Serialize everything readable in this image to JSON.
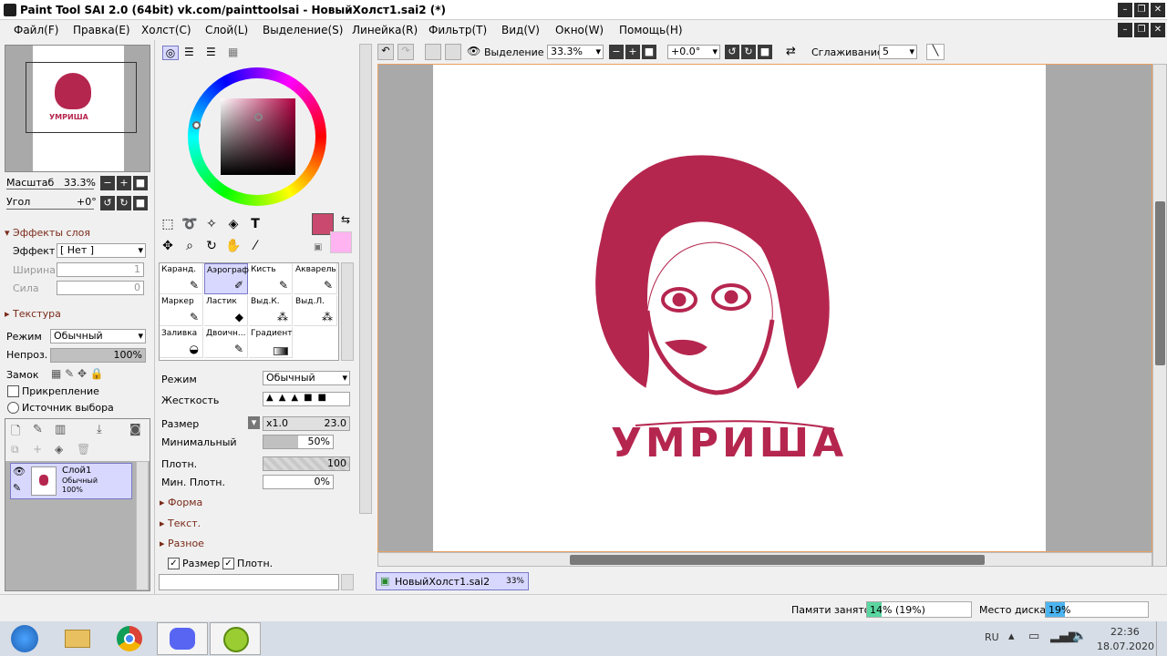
{
  "window": {
    "title": "Paint Tool SAI 2.0 (64bit) vk.com/painttoolsai - НовыйХолст1.sai2 (*)"
  },
  "menu": [
    "Файл(F)",
    "Правка(E)",
    "Холст(C)",
    "Слой(L)",
    "Выделение(S)",
    "Линейка(R)",
    "Фильтр(T)",
    "Вид(V)",
    "Окно(W)",
    "Помощь(H)"
  ],
  "navigator": {
    "zoom_label": "Масштаб",
    "zoom_value": "33.3%",
    "angle_label": "Угол",
    "angle_value": "+0°",
    "preview_text": "УМРИША"
  },
  "layer_effects": {
    "header": "Эффекты слоя",
    "effect_label": "Эффект",
    "effect_value": "[ Нет ]",
    "width_label": "Ширина",
    "width_value": "1",
    "strength_label": "Сила",
    "strength_value": "0"
  },
  "texture": {
    "header": "Текстура"
  },
  "layer_props": {
    "mode_label": "Режим",
    "mode_value": "Обычный",
    "opacity_label": "Непроз.",
    "opacity_value": "100%",
    "lock_label": "Замок",
    "pin_label": "Прикрепление",
    "source_label": "Источник выбора"
  },
  "layers": [
    {
      "name": "Слой1",
      "mode": "Обычный",
      "opacity": "100%"
    }
  ],
  "colors": {
    "primary": "#c94a6e",
    "secondary": "#ffb3f0",
    "art": "#b5264f"
  },
  "brushes": [
    {
      "name": "Каранд.",
      "icon": "pencil-icon"
    },
    {
      "name": "Аэрограф",
      "icon": "airbrush-icon",
      "selected": true
    },
    {
      "name": "Кисть",
      "icon": "brush-icon"
    },
    {
      "name": "Акварель",
      "icon": "watercolor-icon"
    },
    {
      "name": "Маркер",
      "icon": "marker-icon"
    },
    {
      "name": "Ластик",
      "icon": "eraser-icon"
    },
    {
      "name": "Выд.К.",
      "icon": "select-pen-icon"
    },
    {
      "name": "Выд.Л.",
      "icon": "select-eraser-icon"
    },
    {
      "name": "Заливка",
      "icon": "bucket-icon"
    },
    {
      "name": "Двоичн...",
      "icon": "binary-pen-icon"
    },
    {
      "name": "Градиент",
      "icon": "gradient-icon"
    }
  ],
  "tool_settings": {
    "mode_label": "Режим",
    "mode_value": "Обычный",
    "hardness_label": "Жесткость",
    "size_label": "Размер",
    "size_mult": "x1.0",
    "size_value": "23.0",
    "min_label": "Минимальный",
    "min_value": "50%",
    "density_label": "Плотн.",
    "density_value": "100",
    "min_density_label": "Мин. Плотн.",
    "min_density_value": "0%",
    "shape": "Форма",
    "texture": "Текст.",
    "misc": "Разное",
    "chk_size": "Размер",
    "chk_density": "Плотн."
  },
  "toolbar": {
    "selection_label": "Выделение",
    "zoom": "33.3%",
    "angle": "+0.0°",
    "smoothing_label": "Сглаживание",
    "smoothing_value": "5"
  },
  "artwork": {
    "text": "УМРИША"
  },
  "doc_tab": {
    "name": "НовыйХолст1.sai2",
    "zoom": "33%"
  },
  "status": {
    "memory_label": "Памяти занято",
    "memory_value": "14% (19%)",
    "memory_pct": 14,
    "disk_label": "Место диска",
    "disk_value": "19%",
    "disk_pct": 19
  },
  "taskbar": {
    "lang": "RU",
    "time": "22:36",
    "date": "18.07.2020"
  }
}
